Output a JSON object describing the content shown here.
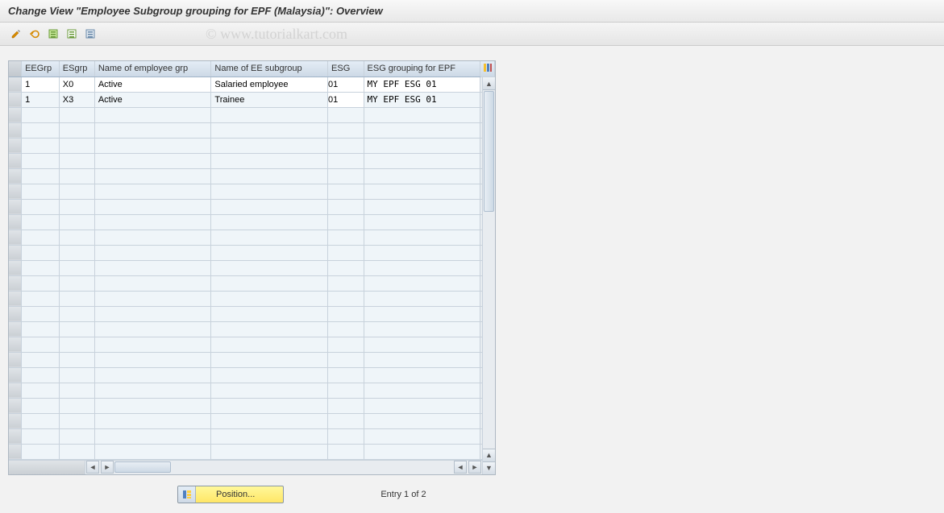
{
  "title": "Change View \"Employee Subgroup grouping for EPF (Malaysia)\": Overview",
  "watermark": "© www.tutorialkart.com",
  "toolbar": {
    "icons": [
      "pencil-ruler",
      "undo",
      "variant",
      "variant-save",
      "variant-delete"
    ]
  },
  "columns": {
    "sel": "",
    "eegrp": "EEGrp",
    "esgrp": "ESgrp",
    "namegrp": "Name of employee grp",
    "nameee": "Name of EE subgroup",
    "esg": "ESG",
    "esggroup": "ESG grouping for EPF"
  },
  "rows": [
    {
      "eegrp": "1",
      "esgrp": "X0",
      "namegrp": "Active",
      "nameee": "Salaried employee",
      "esg": "01",
      "esggroup": "MY EPF ESG 01"
    },
    {
      "eegrp": "1",
      "esgrp": "X3",
      "namegrp": "Active",
      "nameee": "Trainee",
      "esg": "01",
      "esggroup": "MY EPF ESG 01"
    }
  ],
  "footer": {
    "position_label": "Position...",
    "entry_text": "Entry 1 of 2"
  }
}
